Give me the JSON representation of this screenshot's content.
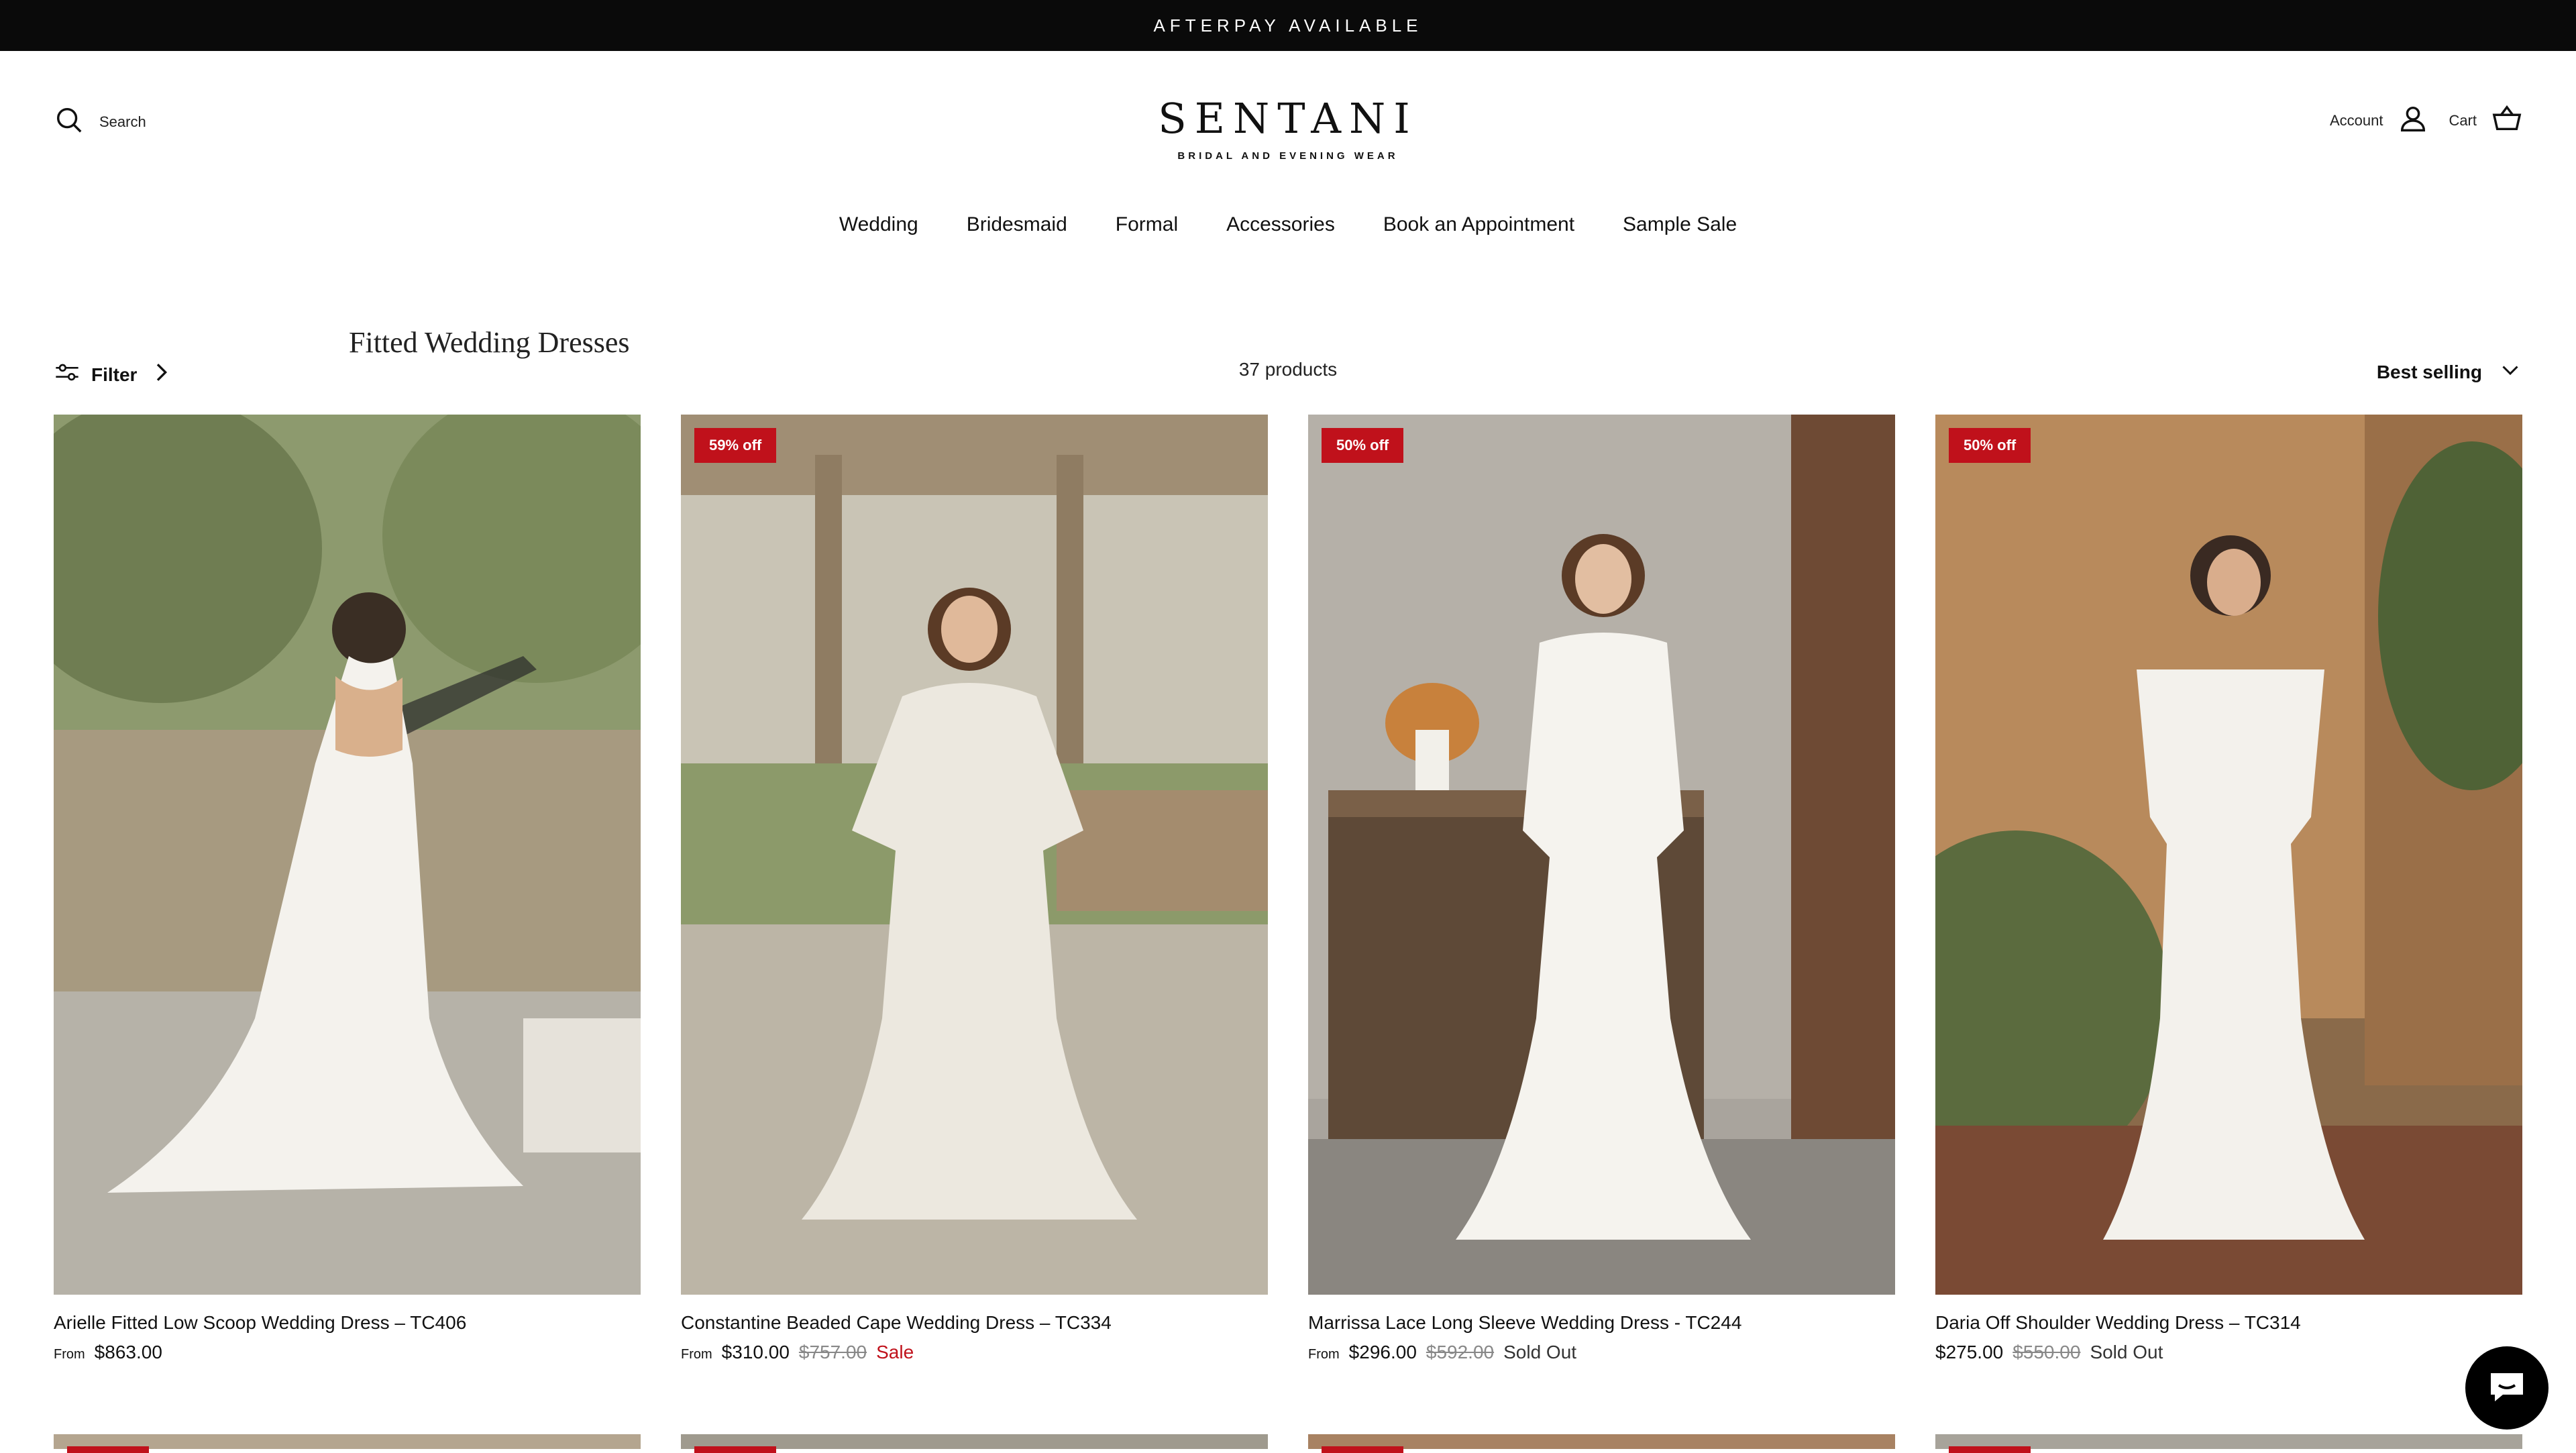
{
  "announcement": "AFTERPAY AVAILABLE",
  "header": {
    "search_label": "Search",
    "logo_name": "SENTANI",
    "logo_tagline": "BRIDAL AND EVENING WEAR",
    "account_label": "Account",
    "cart_label": "Cart"
  },
  "nav": [
    "Wedding",
    "Bridesmaid",
    "Formal",
    "Accessories",
    "Book an Appointment",
    "Sample Sale"
  ],
  "collection": {
    "title": "Fitted Wedding Dresses",
    "filter_label": "Filter",
    "product_count": "37 products",
    "sort_label": "Best selling"
  },
  "products": [
    {
      "name": "Arielle Fitted Low Scoop Wedding Dress – TC406",
      "from": "From",
      "price": "$863.00",
      "was": "",
      "status": "",
      "badge": ""
    },
    {
      "name": "Constantine Beaded Cape Wedding Dress – TC334",
      "from": "From",
      "price": "$310.00",
      "was": "$757.00",
      "status": "Sale",
      "badge": "59% off"
    },
    {
      "name": "Marrissa Lace Long Sleeve Wedding Dress - TC244",
      "from": "From",
      "price": "$296.00",
      "was": "$592.00",
      "status": "Sold Out",
      "badge": "50% off"
    },
    {
      "name": "Daria Off Shoulder Wedding Dress – TC314",
      "from": "",
      "price": "$275.00",
      "was": "$550.00",
      "status": "Sold Out",
      "badge": "50% off"
    }
  ],
  "colors": {
    "announcement_bg": "#0a0a0a",
    "sale_red": "#c0111b",
    "text": "#111111"
  },
  "icons": [
    "search-icon",
    "account-icon",
    "cart-icon",
    "filter-icon",
    "chevron-right-icon",
    "chevron-down-icon",
    "chat-icon"
  ]
}
